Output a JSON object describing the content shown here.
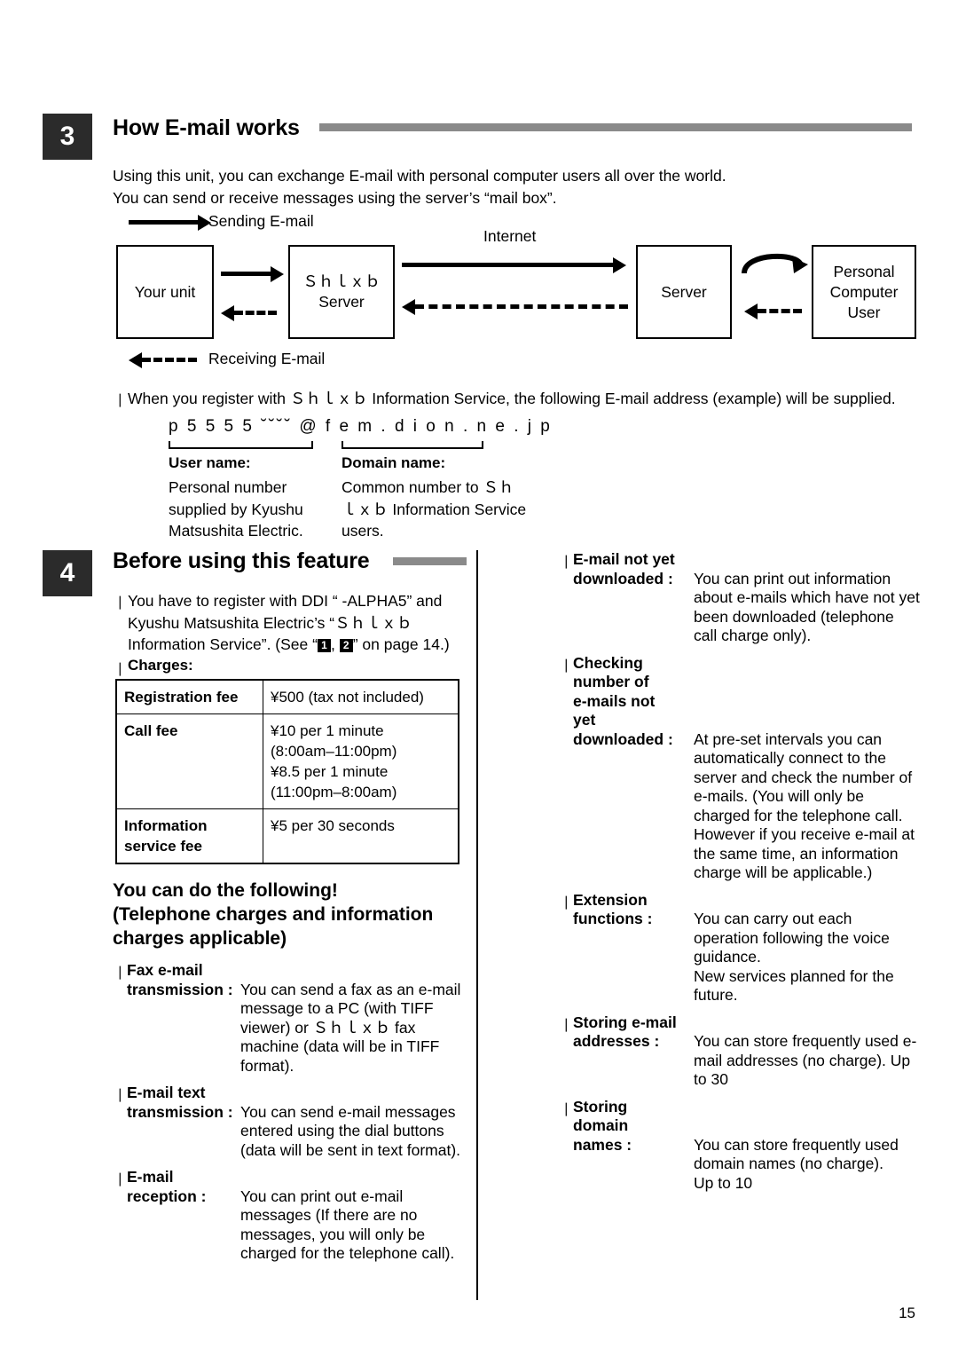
{
  "page": {
    "number": "15"
  },
  "section3": {
    "number": "3",
    "title": "How E-mail works",
    "intro_line1": "Using this unit, you can exchange E-mail with personal computer users all over the world.",
    "intro_line2": "You can send or receive messages using the server’s “mail box”.",
    "diagram": {
      "sending_label": "Sending E-mail",
      "receiving_label": "Receiving E-mail",
      "internet_label": "Internet",
      "box_your_unit": "Your unit",
      "box_server1_line1": "Ｓｈｌｘｂ",
      "box_server1_line2": "Server",
      "box_server2": "Server",
      "box_pc_line1": "Personal",
      "box_pc_line2": "Computer",
      "box_pc_line3": "User"
    },
    "note": "When you register with Ｓｈｌｘｂ  Information Service, the following E-mail address (example) will be supplied.",
    "address_example": "p 5 5 5 5 ˘˘˘˘ @ f e m . d i o n . n e . j p",
    "user_name_head": "User name:",
    "user_name_body": "Personal number supplied by Kyushu Matsushita Electric.",
    "domain_name_head": "Domain name:",
    "domain_name_body": "Common number to Ｓｈｌｘｂ Information Service users."
  },
  "section4": {
    "number": "4",
    "title": "Before using this feature",
    "intro": "You have to register with DDI “ -ALPHA5” and Kyushu Matsushita Electric’s “Ｓｈｌｘｂ Information Service”. (See “",
    "intro_tail": "” on page 14.)",
    "intro_badge1": "1",
    "intro_badge2": "2",
    "intro_comma": ", ",
    "charges_label": "Charges:",
    "charges_table": {
      "rows": [
        {
          "key": "Registration fee",
          "value": "¥500 (tax not included)"
        },
        {
          "key": "Call fee",
          "value": "¥10 per 1 minute\n    (8:00am–11:00pm)\n¥8.5 per 1 minute\n    (11:00pm–8:00am)"
        },
        {
          "key": "Information service fee",
          "value": "¥5 per 30 seconds"
        }
      ]
    },
    "can_do_heading": "You can do the following!\n(Telephone charges and information charges applicable)",
    "features_left": [
      {
        "term": "Fax e-mail\ntransmission :",
        "desc": "You can send a fax as an e-mail message to a PC (with TIFF viewer) or Ｓｈｌｘｂ fax machine (data will be in TIFF format)."
      },
      {
        "term": "E-mail text\ntransmission :",
        "desc": "You can send e-mail messages entered using the dial buttons (data will be sent in text format)."
      },
      {
        "term": "E-mail\nreception :",
        "desc": "You can print out e-mail messages (If there are no messages, you will only be charged for the telephone call)."
      }
    ],
    "features_right": [
      {
        "term": "E-mail not yet\ndownloaded :",
        "desc": "You can print out information about e-mails which have not yet been downloaded (telephone call charge only)."
      },
      {
        "term": "Checking\nnumber of\ne-mails not\nyet\ndownloaded :",
        "desc": "At pre-set intervals you can automatically connect to the server and check the number of e-mails. (You will only be charged for the telephone call. However if you receive e-mail at the same time, an information charge will be applicable.)"
      },
      {
        "term": "Extension\nfunctions :",
        "desc": "You can carry out each operation following the voice guidance.\nNew services planned for the future."
      },
      {
        "term": "Storing e-mail\naddresses :",
        "desc": "You can store frequently used e-mail addresses (no charge). Up to 30"
      },
      {
        "term": "Storing\ndomain\nnames :",
        "desc": "You can store frequently used domain names (no charge).\nUp to 10"
      }
    ]
  }
}
